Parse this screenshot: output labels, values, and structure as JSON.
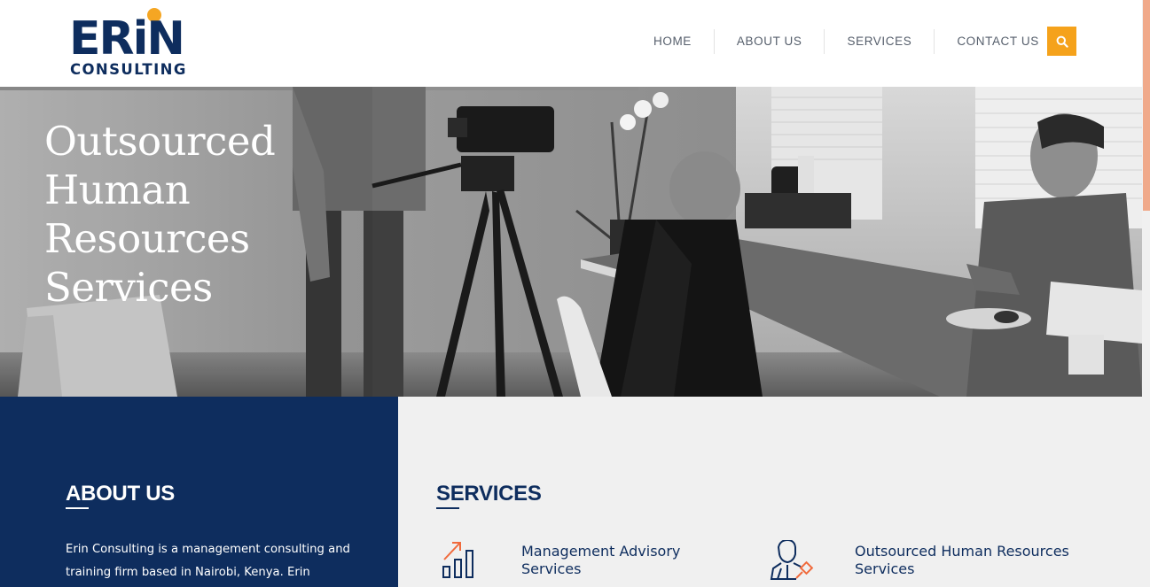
{
  "brand": {
    "logo_main": "ERiN",
    "logo_sub": "CONSULTING",
    "accent_color": "#f5a21b",
    "navy_color": "#0e2d5e"
  },
  "nav": {
    "items": [
      {
        "label": "HOME"
      },
      {
        "label": "ABOUT US"
      },
      {
        "label": "SERVICES"
      },
      {
        "label": "CONTACT US"
      }
    ],
    "search_icon": "search-icon"
  },
  "hero": {
    "title": "Outsourced Human Resources Services"
  },
  "about": {
    "heading": "ABOUT US",
    "text": "Erin Consulting is a management consulting and training firm based in Nairobi, Kenya. Erin"
  },
  "services": {
    "heading": "SERVICES",
    "items": [
      {
        "label": "Management Advisory Services",
        "icon": "bar-chart-growth-icon"
      },
      {
        "label": "Outsourced Human Resources Services",
        "icon": "person-pin-icon"
      }
    ]
  }
}
